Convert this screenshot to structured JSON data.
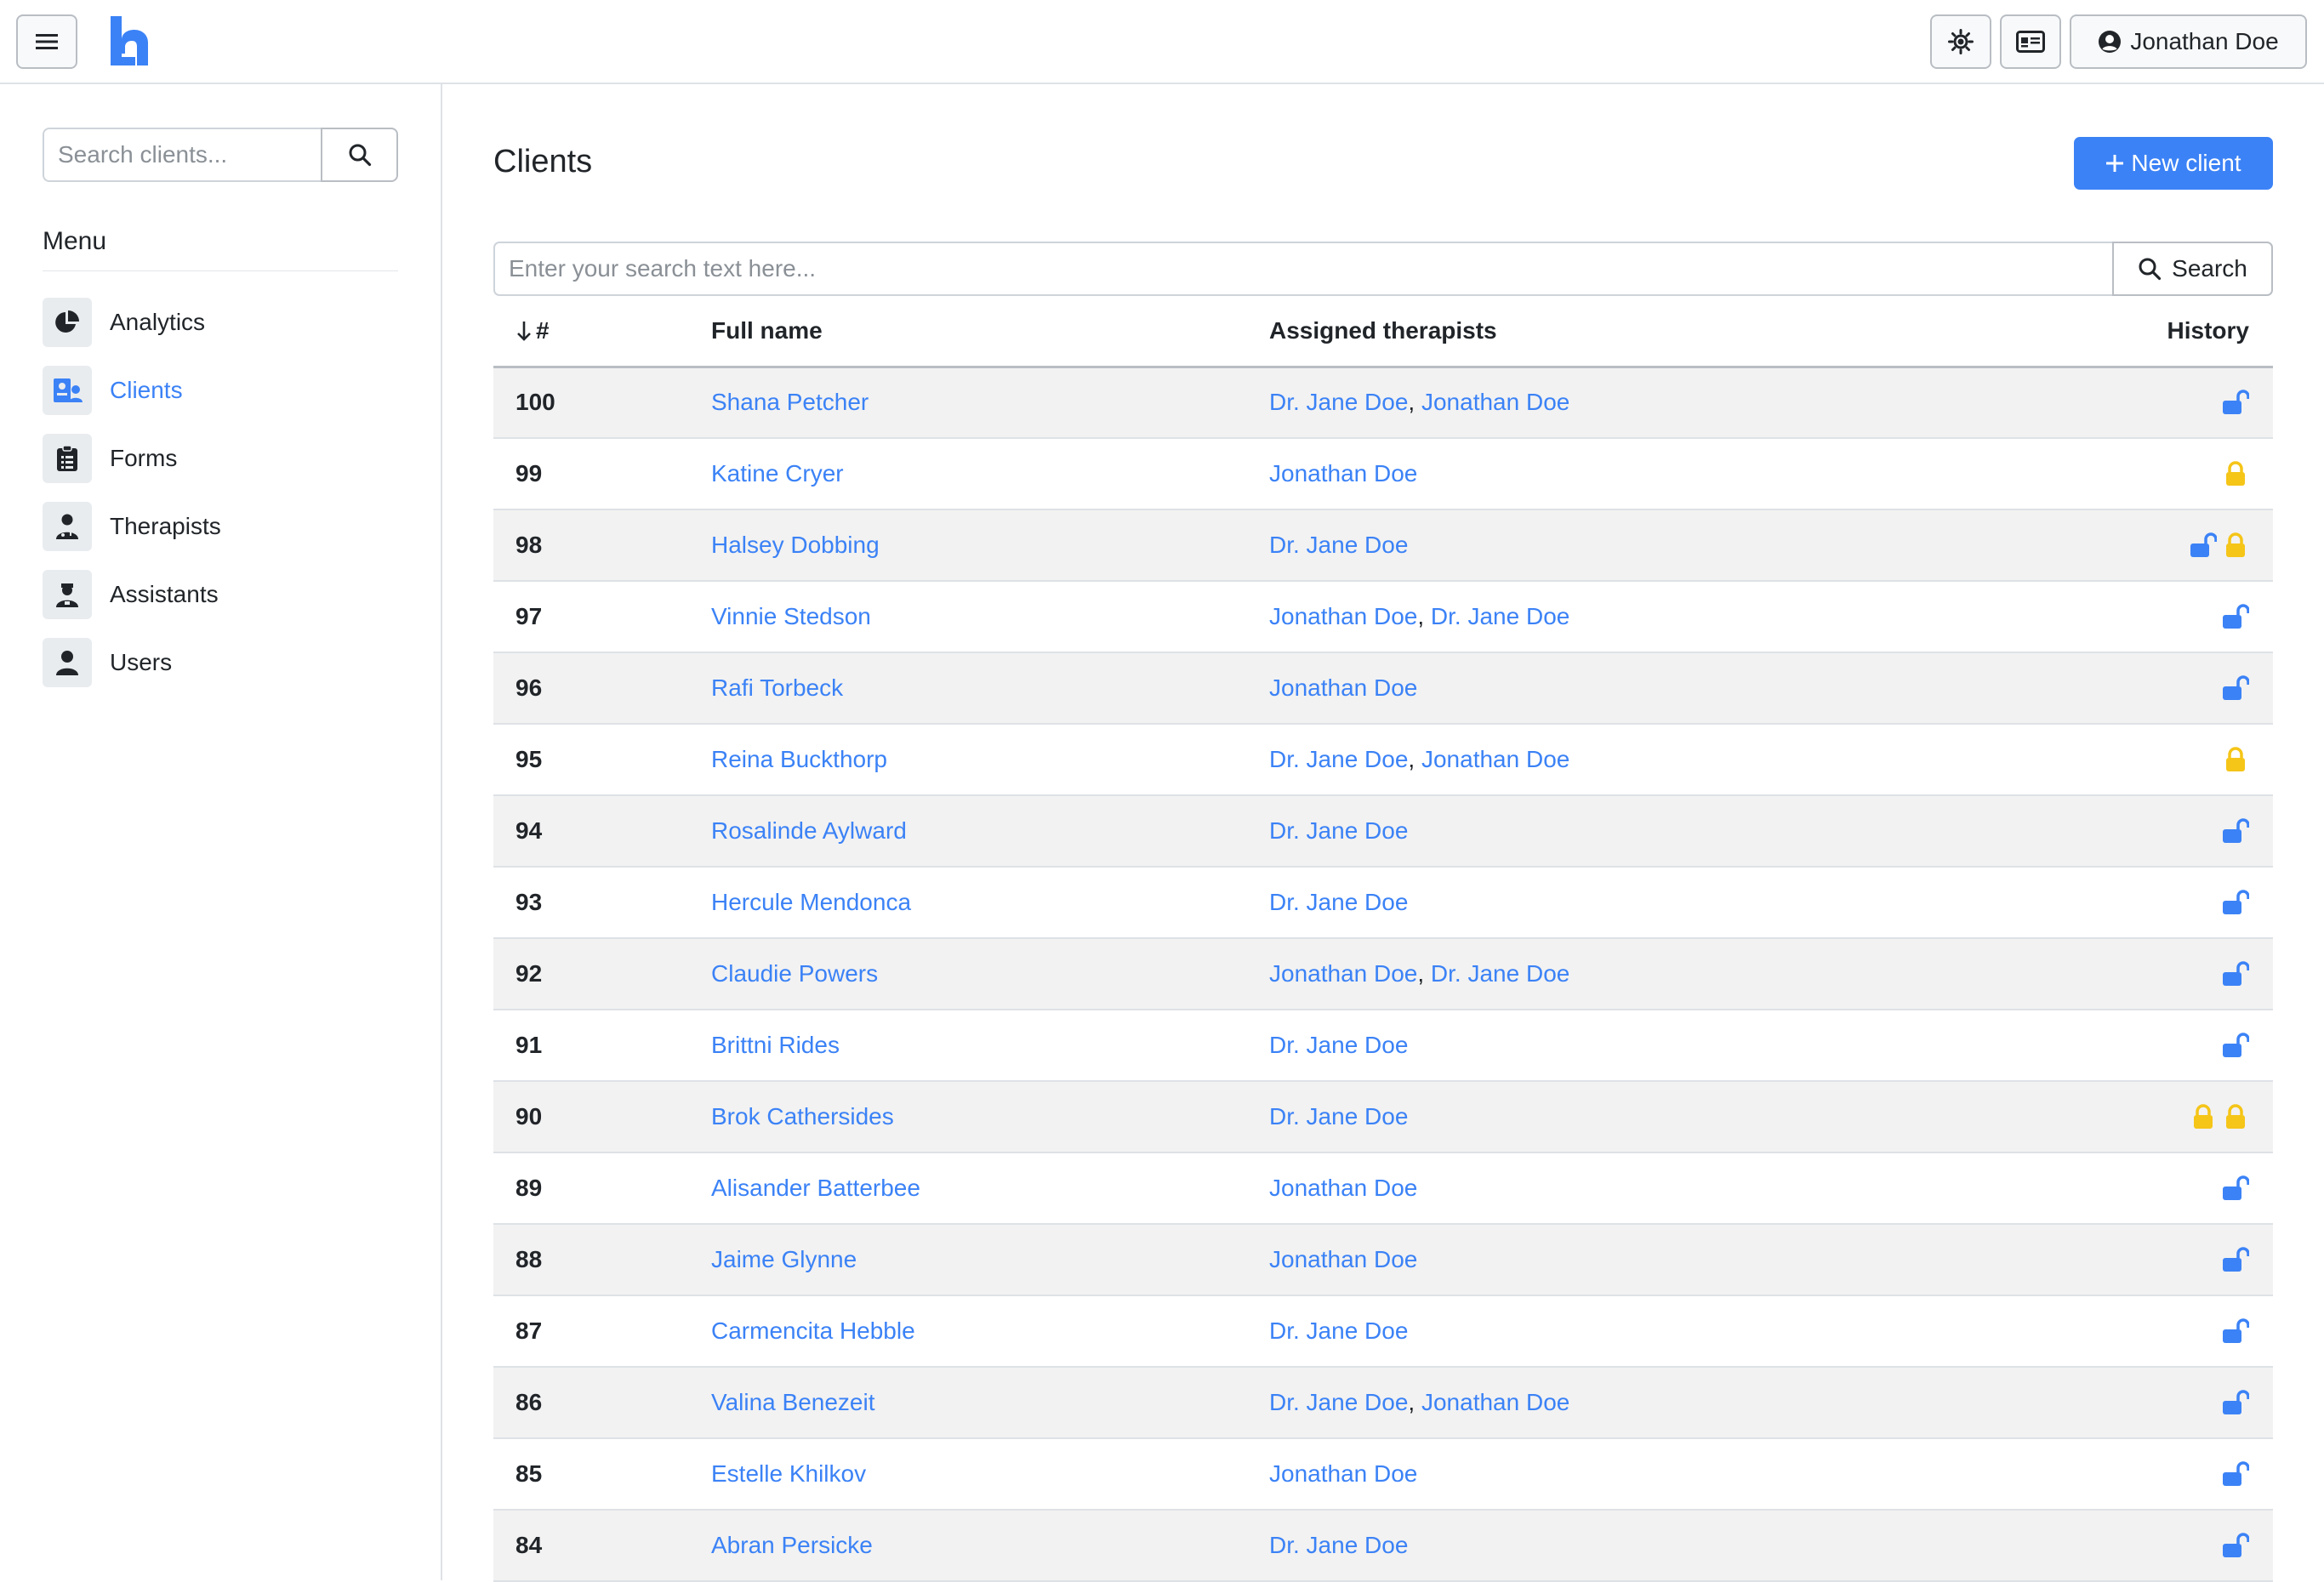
{
  "topbar": {
    "user_name": "Jonathan Doe"
  },
  "sidebar": {
    "search_placeholder": "Search clients...",
    "menu_heading": "Menu",
    "items": [
      {
        "label": "Analytics",
        "icon": "pie-chart-icon",
        "active": false
      },
      {
        "label": "Clients",
        "icon": "clients-icon",
        "active": true
      },
      {
        "label": "Forms",
        "icon": "clipboard-icon",
        "active": false
      },
      {
        "label": "Therapists",
        "icon": "therapist-icon",
        "active": false
      },
      {
        "label": "Assistants",
        "icon": "assistant-icon",
        "active": false
      },
      {
        "label": "Users",
        "icon": "user-icon",
        "active": false
      }
    ]
  },
  "main": {
    "title": "Clients",
    "new_button": "New client",
    "search_placeholder": "Enter your search text here...",
    "search_button": "Search",
    "columns": {
      "num": "#",
      "name": "Full name",
      "therapists": "Assigned therapists",
      "history": "History"
    },
    "rows": [
      {
        "num": "100",
        "name": "Shana Petcher",
        "therapists": [
          "Dr. Jane Doe",
          "Jonathan Doe"
        ],
        "history": [
          "unlocked"
        ]
      },
      {
        "num": "99",
        "name": "Katine Cryer",
        "therapists": [
          "Jonathan Doe"
        ],
        "history": [
          "locked"
        ]
      },
      {
        "num": "98",
        "name": "Halsey Dobbing",
        "therapists": [
          "Dr. Jane Doe"
        ],
        "history": [
          "unlocked",
          "locked"
        ]
      },
      {
        "num": "97",
        "name": "Vinnie Stedson",
        "therapists": [
          "Jonathan Doe",
          "Dr. Jane Doe"
        ],
        "history": [
          "unlocked"
        ]
      },
      {
        "num": "96",
        "name": "Rafi Torbeck",
        "therapists": [
          "Jonathan Doe"
        ],
        "history": [
          "unlocked"
        ]
      },
      {
        "num": "95",
        "name": "Reina Buckthorp",
        "therapists": [
          "Dr. Jane Doe",
          "Jonathan Doe"
        ],
        "history": [
          "locked"
        ]
      },
      {
        "num": "94",
        "name": "Rosalinde Aylward",
        "therapists": [
          "Dr. Jane Doe"
        ],
        "history": [
          "unlocked"
        ]
      },
      {
        "num": "93",
        "name": "Hercule Mendonca",
        "therapists": [
          "Dr. Jane Doe"
        ],
        "history": [
          "unlocked"
        ]
      },
      {
        "num": "92",
        "name": "Claudie Powers",
        "therapists": [
          "Jonathan Doe",
          "Dr. Jane Doe"
        ],
        "history": [
          "unlocked"
        ]
      },
      {
        "num": "91",
        "name": "Brittni Rides",
        "therapists": [
          "Dr. Jane Doe"
        ],
        "history": [
          "unlocked"
        ]
      },
      {
        "num": "90",
        "name": "Brok Cathersides",
        "therapists": [
          "Dr. Jane Doe"
        ],
        "history": [
          "locked",
          "locked"
        ]
      },
      {
        "num": "89",
        "name": "Alisander Batterbee",
        "therapists": [
          "Jonathan Doe"
        ],
        "history": [
          "unlocked"
        ]
      },
      {
        "num": "88",
        "name": "Jaime Glynne",
        "therapists": [
          "Jonathan Doe"
        ],
        "history": [
          "unlocked"
        ]
      },
      {
        "num": "87",
        "name": "Carmencita Hebble",
        "therapists": [
          "Dr. Jane Doe"
        ],
        "history": [
          "unlocked"
        ]
      },
      {
        "num": "86",
        "name": "Valina Benezeit",
        "therapists": [
          "Dr. Jane Doe",
          "Jonathan Doe"
        ],
        "history": [
          "unlocked"
        ]
      },
      {
        "num": "85",
        "name": "Estelle Khilkov",
        "therapists": [
          "Jonathan Doe"
        ],
        "history": [
          "unlocked"
        ]
      },
      {
        "num": "84",
        "name": "Abran Persicke",
        "therapists": [
          "Dr. Jane Doe"
        ],
        "history": [
          "unlocked"
        ]
      }
    ]
  },
  "colors": {
    "accent": "#3b82f6",
    "locked": "#f5c518",
    "row_stripe": "#f2f2f2"
  }
}
